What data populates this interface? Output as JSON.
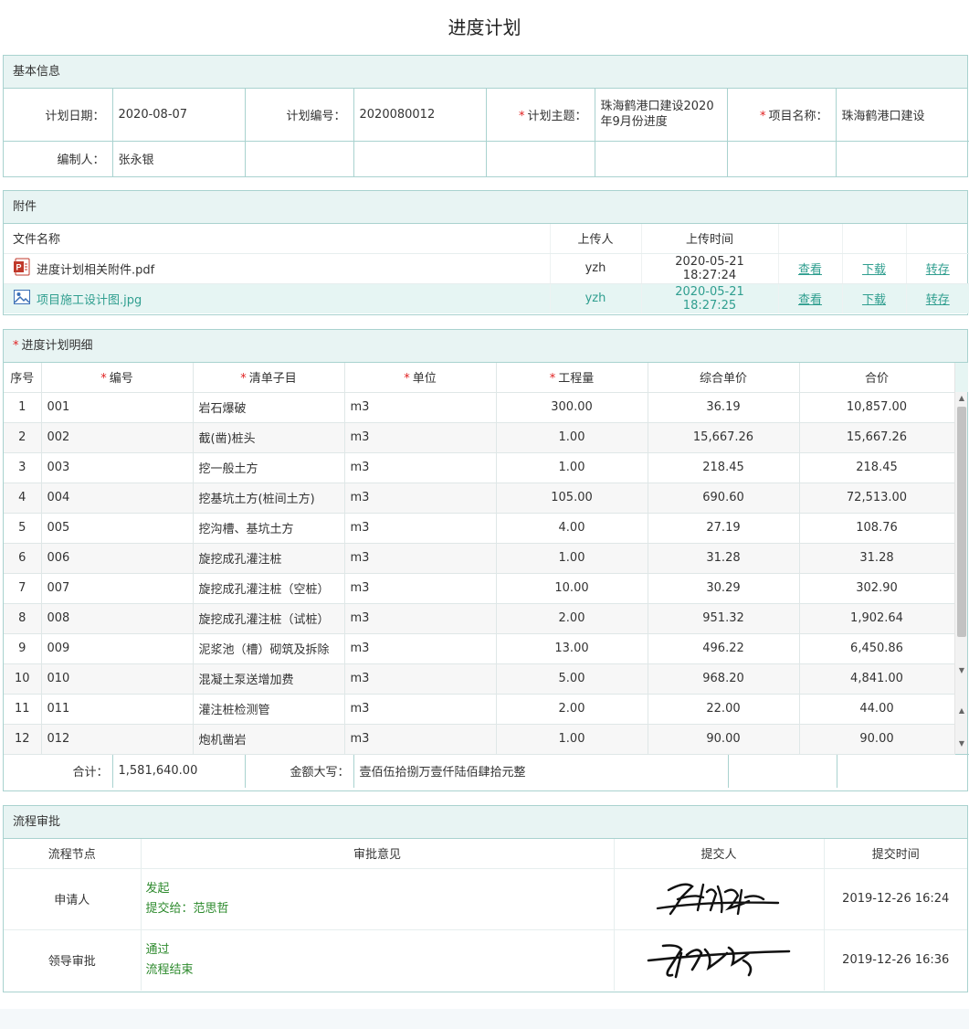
{
  "page": {
    "title": "进度计划"
  },
  "basic": {
    "title": "基本信息",
    "plan_date_label": "计划日期：",
    "plan_date": "2020-08-07",
    "plan_no_label": "计划编号：",
    "plan_no": "2020080012",
    "subject_label": "计划主题：",
    "subject": "珠海鹤港口建设2020年9月份进度",
    "project_label": "项目名称：",
    "project": "珠海鹤港口建设",
    "author_label": "编制人：",
    "author": "张永银"
  },
  "attachments": {
    "title": "附件",
    "headers": {
      "name": "文件名称",
      "uploader": "上传人",
      "time": "上传时间"
    },
    "actions": {
      "view": "查看",
      "download": "下载",
      "save": "转存"
    },
    "files": [
      {
        "name": "进度计划相关附件.pdf",
        "icon": "pdf-file-icon",
        "uploader": "yzh",
        "time": "2020-05-21 18:27:24"
      },
      {
        "name": "项目施工设计图.jpg",
        "icon": "image-file-icon",
        "uploader": "yzh",
        "time": "2020-05-21 18:27:25"
      }
    ]
  },
  "detail": {
    "title": "进度计划明细",
    "headers": {
      "seq": "序号",
      "code": "编号",
      "item": "清单子目",
      "unit": "单位",
      "qty": "工程量",
      "price": "综合单价",
      "total": "合价"
    },
    "rows": [
      {
        "seq": "1",
        "code": "001",
        "item": "岩石爆破",
        "unit": "m3",
        "qty": "300.00",
        "price": "36.19",
        "total": "10,857.00"
      },
      {
        "seq": "2",
        "code": "002",
        "item": "截(凿)桩头",
        "unit": "m3",
        "qty": "1.00",
        "price": "15,667.26",
        "total": "15,667.26"
      },
      {
        "seq": "3",
        "code": "003",
        "item": "挖一般土方",
        "unit": "m3",
        "qty": "1.00",
        "price": "218.45",
        "total": "218.45"
      },
      {
        "seq": "4",
        "code": "004",
        "item": "挖基坑土方(桩间土方)",
        "unit": "m3",
        "qty": "105.00",
        "price": "690.60",
        "total": "72,513.00"
      },
      {
        "seq": "5",
        "code": "005",
        "item": "挖沟槽、基坑土方",
        "unit": "m3",
        "qty": "4.00",
        "price": "27.19",
        "total": "108.76"
      },
      {
        "seq": "6",
        "code": "006",
        "item": "旋挖成孔灌注桩",
        "unit": "m3",
        "qty": "1.00",
        "price": "31.28",
        "total": "31.28"
      },
      {
        "seq": "7",
        "code": "007",
        "item": "旋挖成孔灌注桩（空桩）",
        "unit": "m3",
        "qty": "10.00",
        "price": "30.29",
        "total": "302.90"
      },
      {
        "seq": "8",
        "code": "008",
        "item": "旋挖成孔灌注桩（试桩）",
        "unit": "m3",
        "qty": "2.00",
        "price": "951.32",
        "total": "1,902.64"
      },
      {
        "seq": "9",
        "code": "009",
        "item": "泥浆池（槽）砌筑及拆除",
        "unit": "m3",
        "qty": "13.00",
        "price": "496.22",
        "total": "6,450.86"
      },
      {
        "seq": "10",
        "code": "010",
        "item": "混凝土泵送增加费",
        "unit": "m3",
        "qty": "5.00",
        "price": "968.20",
        "total": "4,841.00"
      },
      {
        "seq": "11",
        "code": "011",
        "item": "灌注桩检测管",
        "unit": "m3",
        "qty": "2.00",
        "price": "22.00",
        "total": "44.00"
      },
      {
        "seq": "12",
        "code": "012",
        "item": "炮机凿岩",
        "unit": "m3",
        "qty": "1.00",
        "price": "90.00",
        "total": "90.00"
      }
    ],
    "sum_label": "合计：",
    "sum_value": "1,581,640.00",
    "sum_upper_label": "金额大写：",
    "sum_upper_value": "壹佰伍拾捌万壹仟陆佰肆拾元整"
  },
  "approval": {
    "title": "流程审批",
    "headers": {
      "node": "流程节点",
      "opinion": "审批意见",
      "submitter": "提交人",
      "time": "提交时间"
    },
    "rows": [
      {
        "node": "申请人",
        "opinion": "发起",
        "opinion2": "提交给：范思哲",
        "time": "2019-12-26 16:24"
      },
      {
        "node": "领导审批",
        "opinion": "通过",
        "opinion2": "流程结束",
        "time": "2019-12-26 16:36"
      }
    ]
  },
  "colors": {
    "accent": "#2f9e8f",
    "border": "#a9d2cf",
    "header_bg": "#e8f4f3",
    "required": "#e02020",
    "approval_text": "#2d8a2d"
  }
}
